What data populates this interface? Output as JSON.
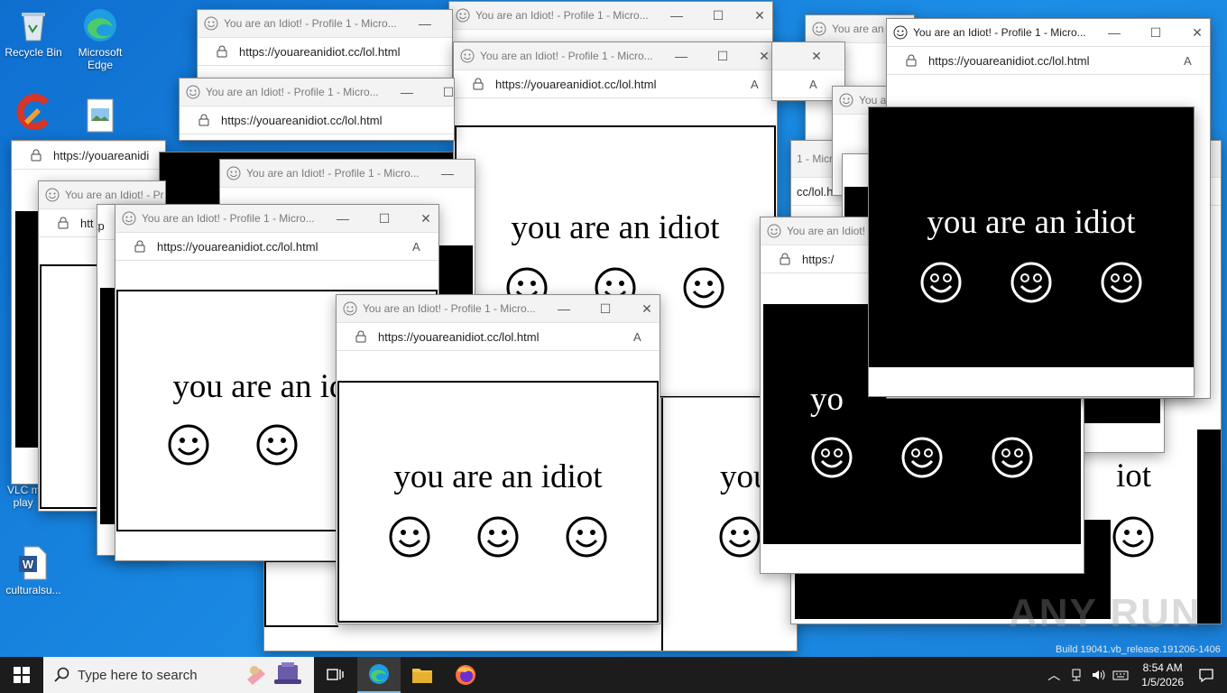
{
  "desktop": {
    "icons": [
      {
        "label": "Recycle Bin",
        "icon": "recycle-bin-icon"
      },
      {
        "label": "Microsoft Edge",
        "icon": "edge-icon"
      },
      {
        "label": "",
        "icon": "ccleaner-icon"
      },
      {
        "label": "",
        "icon": "image-file-icon"
      },
      {
        "label": "VLC m... play...",
        "icon": "vlc-icon"
      },
      {
        "label": "culturalsu...",
        "icon": "word-document-icon"
      }
    ]
  },
  "popup": {
    "title": "You are an Idiot! - Profile 1 - Micro...",
    "url": "https://youareanidiot.cc/lol.html",
    "message": "you are an idiot",
    "minimize_label": "—",
    "maximize_label": "☐",
    "close_label": "✕"
  },
  "partials": {
    "url_short_1": "https://youareanidi",
    "url_short_2": "htt",
    "url_short_3": "http",
    "url_short_4": "https:/",
    "title_short_1": "You are an Idiot! - Pr",
    "title_short_2": "You are an I",
    "title_short_3": "You are an Id",
    "title_short_4": "1 - Micro",
    "message_short_1": "y",
    "message_short_2": "you are an i",
    "message_short_3": "you",
    "message_short_4": "yo",
    "message_short_5": "iot",
    "addr_short_1": "ntt",
    "addr_short_2": "cc/lol.html"
  },
  "taskbar": {
    "search_placeholder": "Type here to search",
    "time": "8:54 AM",
    "date": "1/5/2026"
  },
  "watermark": "ANY RUN",
  "build_text": "Build 19041.vb_release.191206-1406",
  "colors": {
    "accent": "#0078d4",
    "desktop": "#1a8be0",
    "taskbar": "#1c1c1c"
  }
}
